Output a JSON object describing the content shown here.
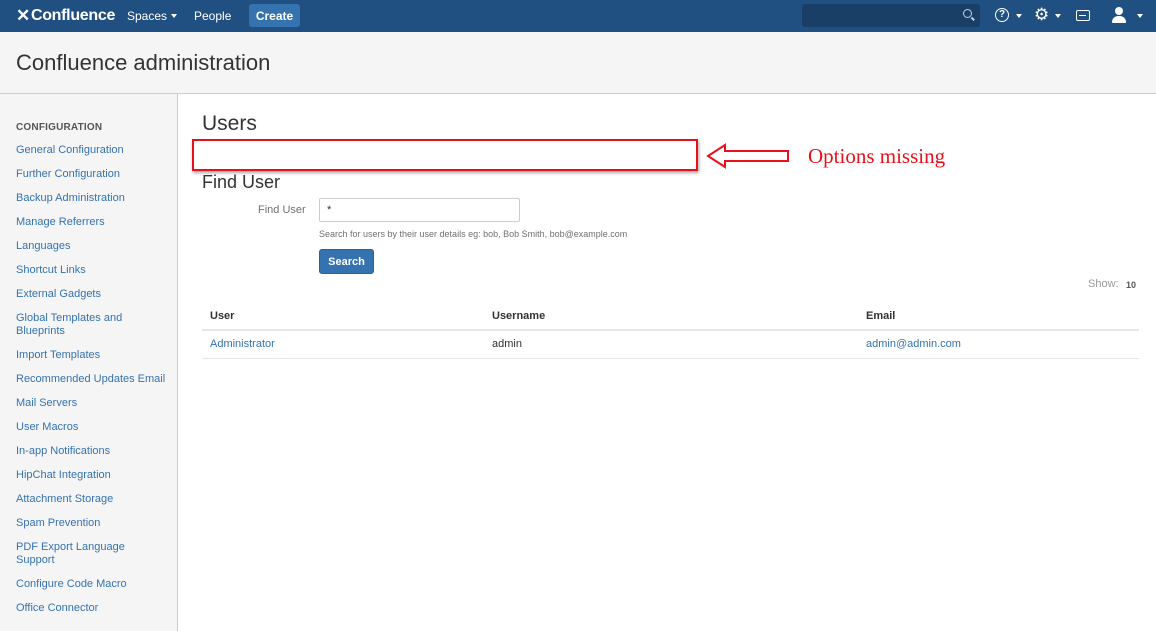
{
  "topnav": {
    "logo": "Confluence",
    "spaces": "Spaces",
    "people": "People",
    "create": "Create"
  },
  "header": {
    "title": "Confluence administration"
  },
  "sidebar": {
    "section": "CONFIGURATION",
    "items": [
      "General Configuration",
      "Further Configuration",
      "Backup Administration",
      "Manage Referrers",
      "Languages",
      "Shortcut Links",
      "External Gadgets",
      "Global Templates and Blueprints",
      "Import Templates",
      "Recommended Updates Email",
      "Mail Servers",
      "User Macros",
      "In-app Notifications",
      "HipChat Integration",
      "Attachment Storage",
      "Spam Prevention",
      "PDF Export Language Support",
      "Configure Code Macro",
      "Office Connector"
    ]
  },
  "main": {
    "title": "Users",
    "annotation": "Options missing",
    "find_title": "Find User",
    "find_label": "Find User",
    "find_value": "*",
    "find_hint": "Search for users by their user details eg: bob, Bob Smith, bob@example.com",
    "search_button": "Search",
    "show_label": "Show:",
    "show_value": "10",
    "table": {
      "headers": [
        "User",
        "Username",
        "Email"
      ],
      "rows": [
        {
          "user": "Administrator",
          "username": "admin",
          "email": "admin@admin.com"
        }
      ]
    }
  },
  "colors": {
    "nav_bg": "#205081",
    "link": "#3572b0",
    "annotation": "#e8101a"
  }
}
